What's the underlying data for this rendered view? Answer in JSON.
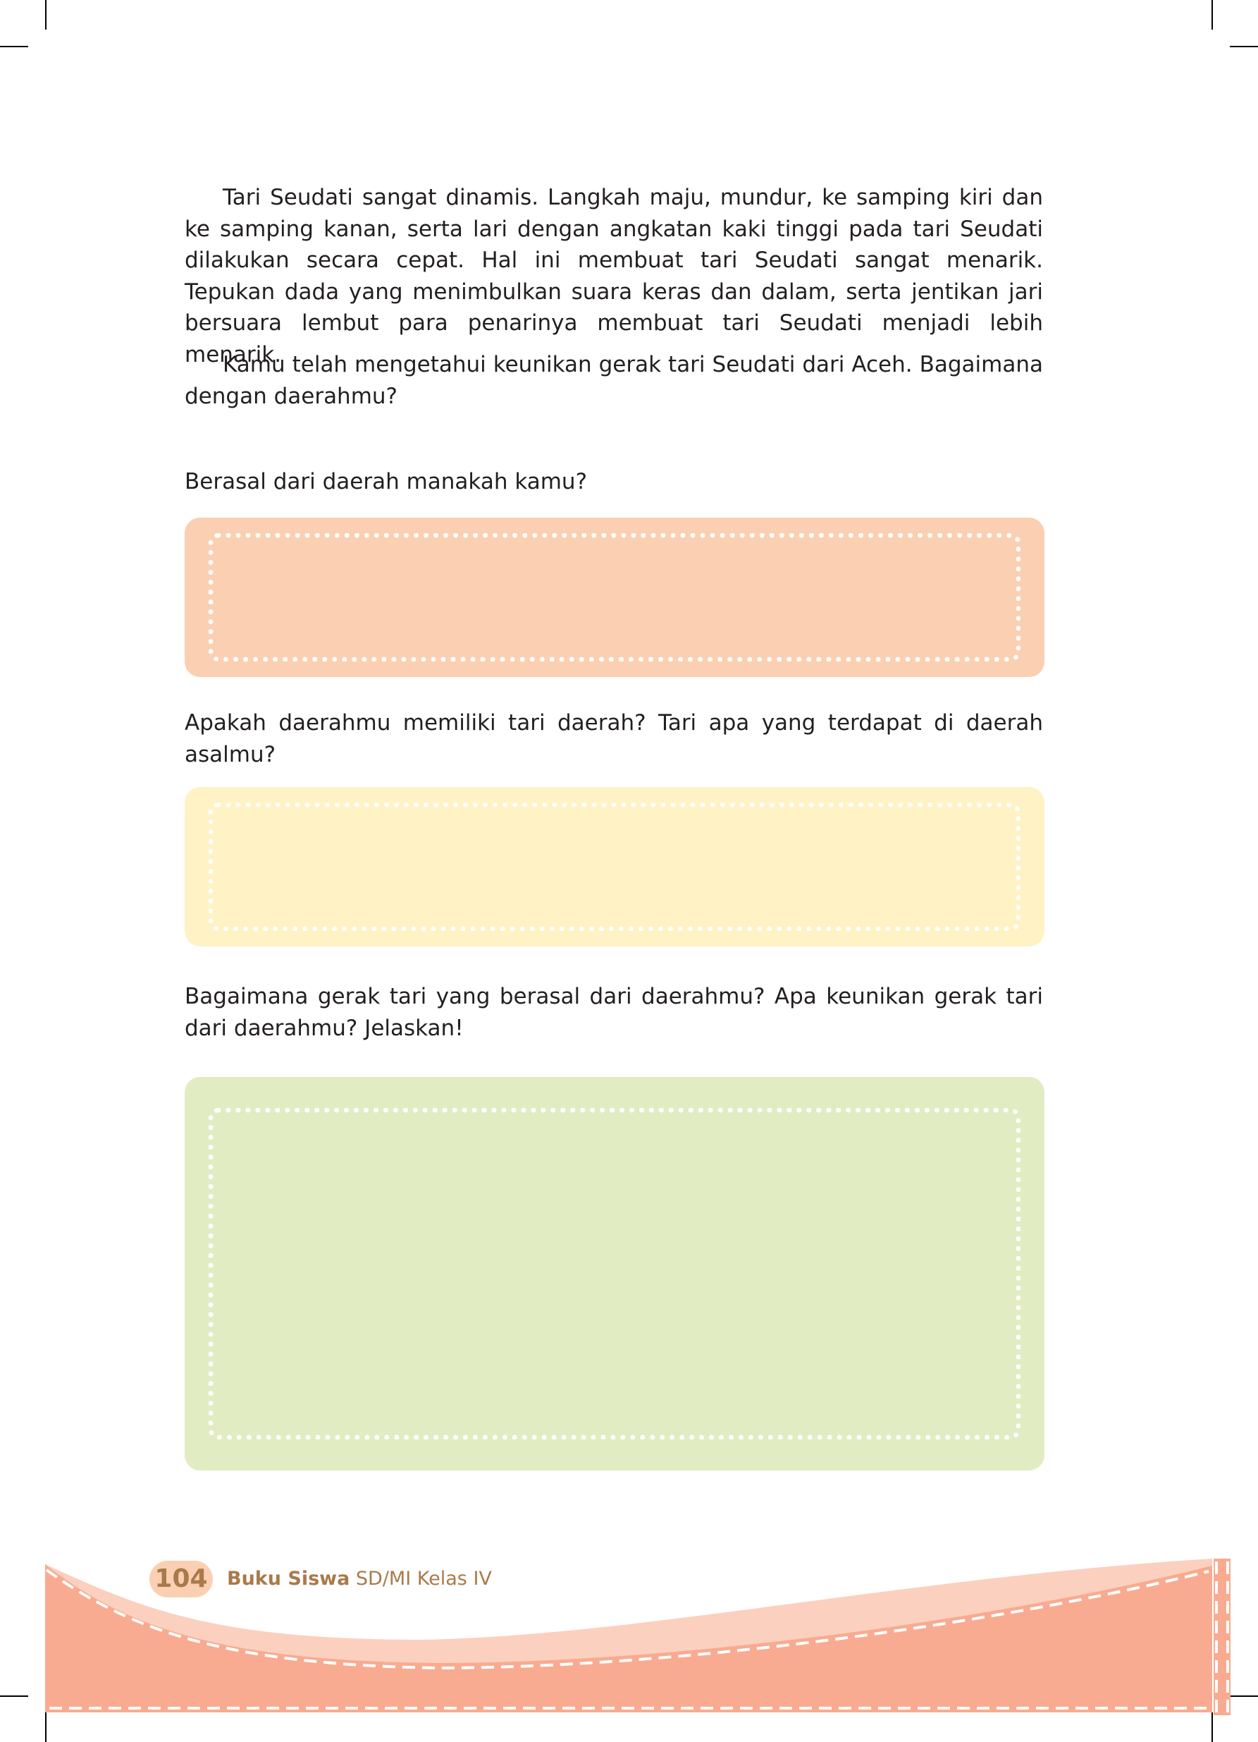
{
  "content": {
    "paragraphs": [
      "Tari Seudati sangat dinamis. Langkah maju, mundur, ke samping kiri dan ke samping kanan, serta lari dengan angkatan kaki tinggi pada tari Seudati dilakukan secara cepat. Hal ini membuat tari Seudati sangat menarik. Tepukan dada yang menimbulkan suara keras dan dalam, serta jentikan jari bersuara lembut para penarinya membuat tari Seudati menjadi lebih menarik.",
      "Kamu telah mengetahui keunikan gerak tari Seudati dari Aceh. Bagaimana dengan daerahmu?"
    ],
    "questions": [
      "Berasal dari daerah manakah kamu?",
      "Apakah daerahmu memiliki tari daerah? Tari apa yang terdapat di daerah asalmu?",
      "Bagaimana gerak tari yang berasal dari daerahmu? Apa keunikan gerak tari dari daerahmu? Jelaskan!"
    ]
  },
  "footer": {
    "page_number": "104",
    "book_title_bold": "Buku Siswa",
    "book_title_rest": " SD/MI Kelas IV"
  },
  "colors": {
    "box_1": "#fbcfb1",
    "box_2": "#fff2c5",
    "box_3": "#e2ecc2",
    "footer_band": "#f8ab90",
    "footer_band_light": "#fbd0bf",
    "footer_text": "#a97a4a"
  }
}
